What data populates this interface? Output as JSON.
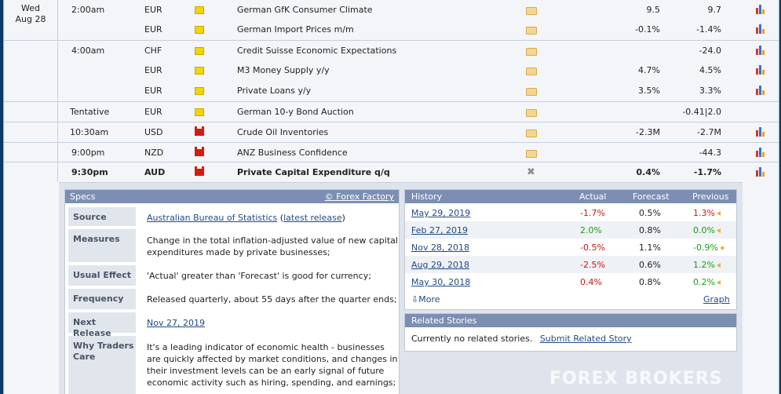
{
  "calendar": {
    "date_day": "Wed",
    "date_month_day": "Aug 28",
    "rows": [
      {
        "time": "2:00am",
        "currency": "EUR",
        "impact": "yellow",
        "event": "German GfK Consumer Climate",
        "actual": "",
        "forecast": "9.5",
        "previous": "9.7",
        "graph": true
      },
      {
        "time": "",
        "currency": "EUR",
        "impact": "yellow",
        "event": "German Import Prices m/m",
        "actual": "",
        "forecast": "-0.1%",
        "previous": "-1.4%",
        "graph": true
      },
      {
        "time": "4:00am",
        "currency": "CHF",
        "impact": "yellow",
        "event": "Credit Suisse Economic Expectations",
        "actual": "",
        "forecast": "",
        "previous": "-24.0",
        "graph": true
      },
      {
        "time": "",
        "currency": "EUR",
        "impact": "yellow",
        "event": "M3 Money Supply y/y",
        "actual": "",
        "forecast": "4.7%",
        "previous": "4.5%",
        "graph": true
      },
      {
        "time": "",
        "currency": "EUR",
        "impact": "yellow",
        "event": "Private Loans y/y",
        "actual": "",
        "forecast": "3.5%",
        "previous": "3.3%",
        "graph": true
      },
      {
        "time": "Tentative",
        "currency": "EUR",
        "impact": "yellow",
        "event": "German 10-y Bond Auction",
        "actual": "",
        "forecast": "",
        "previous": "-0.41|2.0",
        "graph": false
      },
      {
        "time": "10:30am",
        "currency": "USD",
        "impact": "red",
        "event": "Crude Oil Inventories",
        "actual": "",
        "forecast": "-2.3M",
        "previous": "-2.7M",
        "graph": true
      },
      {
        "time": "9:00pm",
        "currency": "NZD",
        "impact": "red",
        "event": "ANZ Business Confidence",
        "actual": "",
        "forecast": "",
        "previous": "-44.3",
        "graph": true
      },
      {
        "time": "9:30pm",
        "currency": "AUD",
        "impact": "red",
        "event": "Private Capital Expenditure q/q",
        "actual": "",
        "forecast": "0.4%",
        "previous": "-1.7%",
        "graph": true
      }
    ]
  },
  "specs": {
    "title": "Specs",
    "credit": "© Forex Factory",
    "source_label": "Source",
    "source_link": "Australian Bureau of Statistics",
    "source_open": "(",
    "source_latest": "latest release",
    "source_close": ")",
    "measures_label": "Measures",
    "measures_value": "Change in the total inflation-adjusted value of new capital expenditures made by private businesses;",
    "usual_label": "Usual Effect",
    "usual_value": "'Actual' greater than 'Forecast' is good for currency;",
    "frequency_label": "Frequency",
    "frequency_value": "Released quarterly, about 55 days after the quarter ends;",
    "next_label": "Next Release",
    "next_value": "Nov 27, 2019",
    "why_label": "Why Traders Care",
    "why_value": "It's a leading indicator of economic health - businesses are quickly affected by market conditions, and changes in their investment levels can be an early signal of future economic activity such as hiring, spending, and earnings;"
  },
  "history": {
    "title": "History",
    "col_actual": "Actual",
    "col_forecast": "Forecast",
    "col_previous": "Previous",
    "rows": [
      {
        "date": "May 29, 2019",
        "actual": "-1.7%",
        "actual_color": "red",
        "forecast": "0.5%",
        "previous": "1.3%",
        "previous_color": "red"
      },
      {
        "date": "Feb 27, 2019",
        "actual": "2.0%",
        "actual_color": "green",
        "forecast": "0.8%",
        "previous": "0.0%",
        "previous_color": "green"
      },
      {
        "date": "Nov 28, 2018",
        "actual": "-0.5%",
        "actual_color": "red",
        "forecast": "1.1%",
        "previous": "-0.9%",
        "previous_color": "green"
      },
      {
        "date": "Aug 29, 2018",
        "actual": "-2.5%",
        "actual_color": "red",
        "forecast": "0.6%",
        "previous": "1.2%",
        "previous_color": "green"
      },
      {
        "date": "May 30, 2018",
        "actual": "0.4%",
        "actual_color": "red",
        "forecast": "0.8%",
        "previous": "0.2%",
        "previous_color": "green"
      }
    ],
    "more": "More",
    "graph": "Graph"
  },
  "related": {
    "title": "Related Stories",
    "text": "Currently no related stories.",
    "link": "Submit Related Story"
  },
  "watermark": "FOREX BROKERS",
  "colors": {
    "red": "#cc1515",
    "green": "#1d9e0f",
    "header": "#7c8fb2",
    "link": "#224a86"
  }
}
